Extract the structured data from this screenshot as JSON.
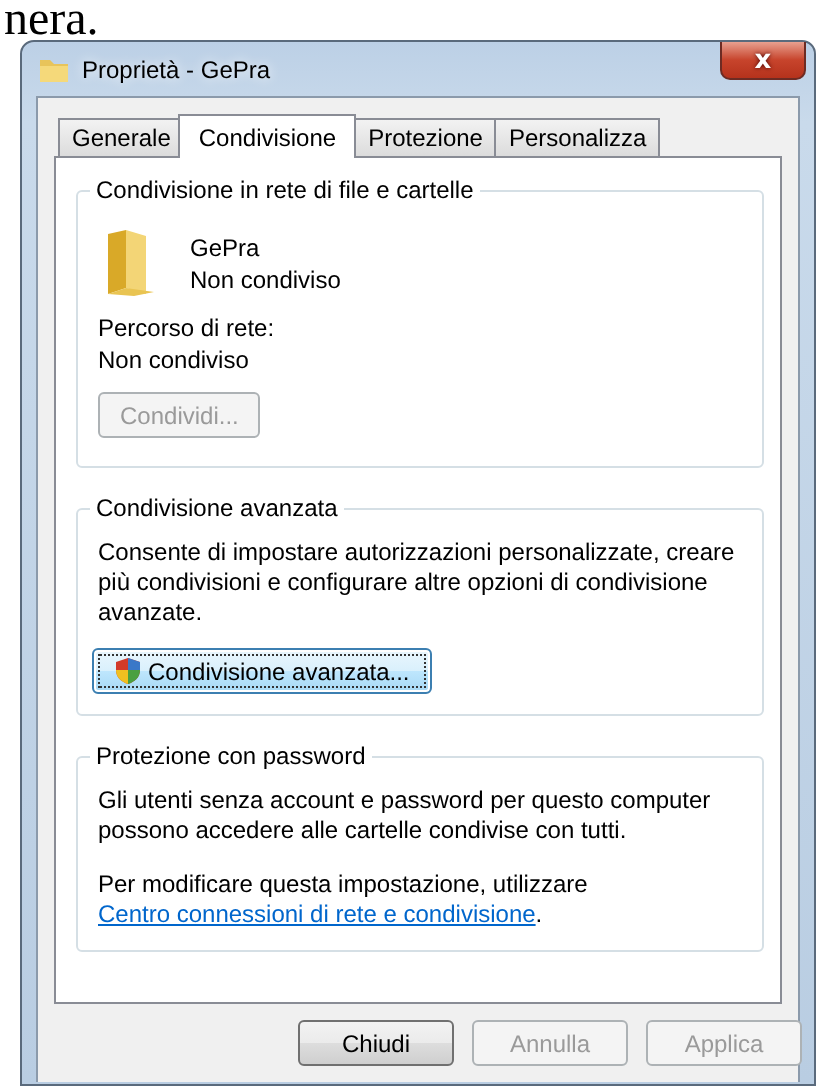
{
  "page_heading": "nera.",
  "window": {
    "title": "Proprietà - GePra",
    "close": "x"
  },
  "tabs": [
    {
      "label": "Generale",
      "selected": false
    },
    {
      "label": "Condivisione",
      "selected": true
    },
    {
      "label": "Protezione",
      "selected": false
    },
    {
      "label": "Personalizza",
      "selected": false
    }
  ],
  "network_sharing": {
    "title": "Condivisione in rete di file e cartelle",
    "folder_name": "GePra",
    "folder_status": "Non condiviso",
    "path_label": "Percorso di rete:",
    "path_value": "Non condiviso",
    "button": {
      "label": "Condividi...",
      "disabled": true
    }
  },
  "advanced_sharing": {
    "title": "Condivisione avanzata",
    "description": "Consente di impostare autorizzazioni personalizzate, creare più condivisioni e configurare altre opzioni di condivisione avanzate.",
    "button": {
      "label": "Condivisione avanzata...",
      "disabled": false
    }
  },
  "password_protection": {
    "title": "Protezione con password",
    "description": "Gli utenti senza account e password per questo computer possono accedere alle cartelle condivise con tutti.",
    "hint": "Per modificare questa impostazione, utilizzare",
    "link": "Centro connessioni di rete e condivisione",
    "hint_end": "."
  },
  "buttons": [
    {
      "label": "Chiudi",
      "disabled": false
    },
    {
      "label": "Annulla",
      "disabled": true
    },
    {
      "label": "Applica",
      "disabled": true
    }
  ]
}
